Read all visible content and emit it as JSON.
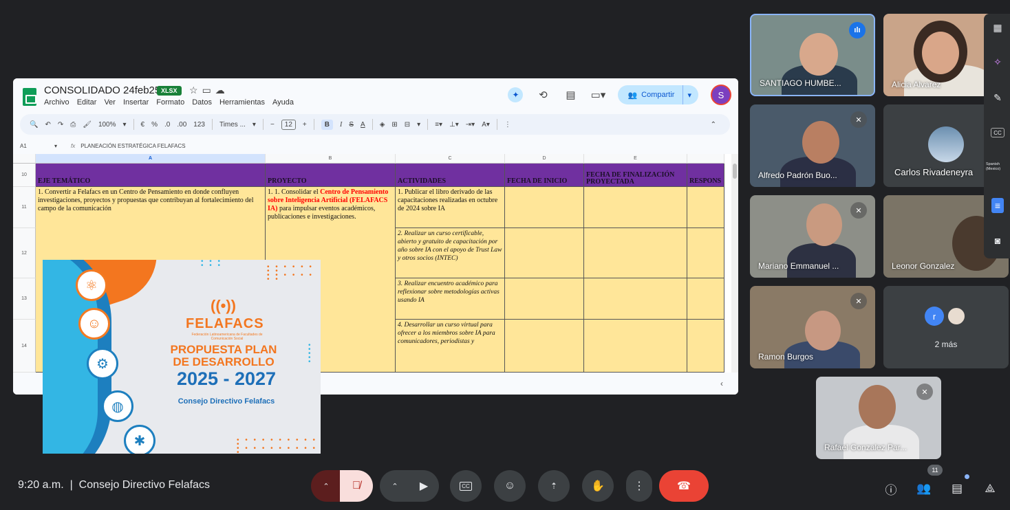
{
  "sheet": {
    "title": "CONSOLIDADO 24feb25",
    "badge": "XLSX",
    "menu": [
      "Archivo",
      "Editar",
      "Ver",
      "Insertar",
      "Formato",
      "Datos",
      "Herramientas",
      "Ayuda"
    ],
    "share_label": "Compartir",
    "user_initial": "S",
    "toolbar": {
      "zoom": "100%",
      "currency": "€",
      "percent": "%",
      "dec_less": ".0",
      "dec_more": ".00",
      "format_123": "123",
      "font": "Times ...",
      "font_size": "12",
      "bold": "B",
      "italic": "I"
    },
    "cell_ref": "A1",
    "formula": "PLANEACIÓN ESTRATÉGICA FELAFACS",
    "columns": [
      "A",
      "B",
      "C",
      "D",
      "E"
    ],
    "rows": [
      "10",
      "11",
      "12",
      "13",
      "14"
    ],
    "headers": [
      "EJE TEMÁTICO",
      "PROYECTO",
      "ACTIVIDADES",
      "FECHA DE INICIO",
      "FECHA DE FINALIZACIÓN PROYECTADA",
      "RESPONS"
    ],
    "cell_a11": "1.     Convertir a Felafacs en un Centro de Pensamiento en donde confluyen investigaciones, proyectos y propuestas que contribuyan al fortalecimiento del campo de la comunicación",
    "cell_b11_pre": "1. 1.       Consolidar  el ",
    "cell_b11_red": "Centro de Pensamiento sobre Inteligencia Artificial (FELAFACS IA)",
    "cell_b11_post": " para impulsar eventos académicos, publicaciones e investigaciones.",
    "activities": [
      "1. Publicar el libro derivado de las capacitaciones realizadas en octubre de 2024 sobre IA",
      "2. Realizar un curso certificable, abierto y gratuito de capacitación por año sobre IA con el apoyo de Trust Law y otros socios (INTEC)",
      "3. Realizar encuentro académico para reflexionar sobre metodologías activas usando IA",
      "4. Desarrollar un curso virtual para ofrecer a los miembros sobre IA para comunicadores, periodistas y"
    ]
  },
  "slide": {
    "brand": "FELAFACS",
    "subtitle": "Federación Latinoamericana de Facultades de Comunicación Social",
    "heading_1": "PROPUESTA PLAN",
    "heading_2": "DE DESARROLLO",
    "years": "2025 - 2027",
    "council": "Consejo Directivo Felafacs"
  },
  "participants": [
    {
      "name": "SANTIAGO HUMBE..."
    },
    {
      "name": "Alicia Alvarez"
    },
    {
      "name": "Alfredo Padrón Buo..."
    },
    {
      "name": "Carlos Rivadeneyra"
    },
    {
      "name": "Mariano Emmanuel ..."
    },
    {
      "name": "Leonor Gonzalez"
    },
    {
      "name": "Ramon Burgos"
    },
    {
      "name": "Rafael Gonzalez Par..."
    }
  ],
  "more": {
    "avatar_letter": "r",
    "label": "2 más"
  },
  "side_panel": {
    "cc": "CC",
    "lang": "Spanish (Mexico)"
  },
  "bottom": {
    "time": "9:20 a.m.",
    "meeting": "Consejo Directivo Felafacs",
    "separator": "|",
    "cc_label": "CC",
    "people_count": "11"
  },
  "colors": {
    "header_purple": "#7030a0",
    "cell_yellow": "#ffe699",
    "felafacs_orange": "#f3761f",
    "felafacs_blue": "#1d6fb8",
    "end_call": "#ea4335"
  }
}
